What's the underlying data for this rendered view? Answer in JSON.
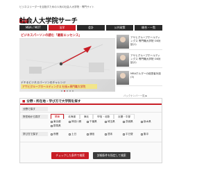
{
  "header": {
    "tagline": "ビジネスリーダーを目指すための人気の社会人大学院・専門サイト",
    "badge": "日刊",
    "title": "社会人大学院サーチ"
  },
  "nav": {
    "items": [
      {
        "label": "MBA / MOT",
        "active": false
      },
      {
        "label": "法学",
        "active": true
      },
      {
        "label": "会計",
        "active": false
      },
      {
        "label": "公共政策",
        "active": false
      },
      {
        "label": "総合・一覧",
        "active": false
      }
    ]
  },
  "hero": {
    "heading": "ビジネスパーソンの読む「最新エッセンス」",
    "caption": "デキるビジネスパーソンのチャレンジ",
    "sub": "アサヒグループホールディングス 社長×専門職大学院",
    "dots": 5,
    "active_dot": 1
  },
  "sidebar": {
    "items": [
      {
        "text": "アサヒグループホールディングス 専門職大学院 OB対談(1)"
      },
      {
        "text": "アサヒグループホールディングス 専門職大学院 OB対談(2)"
      },
      {
        "text": "MBAホルダーの経営者対談 (3)"
      }
    ],
    "more": "バックナンバー一覧 ▶"
  },
  "search": {
    "heading": "分野・所在地・学び方で大学院を探す",
    "rows": {
      "field": {
        "label": "分野で探す",
        "options": [
          "MBA/MOT",
          "法学",
          "会計",
          "公共政策",
          "教育・心理"
        ]
      },
      "area": {
        "label": "所在地から探す",
        "tabs": [
          "関東",
          "北海道",
          "東北",
          "甲信・北陸",
          "近畿・中部"
        ],
        "active_tab": 0,
        "checks": [
          "東京都",
          "神奈川県",
          "千葉県",
          "埼玉県",
          "茨城県",
          "栃木県",
          "群馬県"
        ]
      },
      "style": {
        "label": "学び方で探す",
        "checks": [
          "夜間",
          "土日",
          "通信",
          "週末",
          "平日昼",
          "集中"
        ]
      }
    },
    "buttons": {
      "check_search": "チェックした条件で検索",
      "detail_search": "詳細条件を指定して検索"
    }
  },
  "colors": {
    "accent": "#c81d25",
    "nav_dark": "#2b2b2b"
  }
}
